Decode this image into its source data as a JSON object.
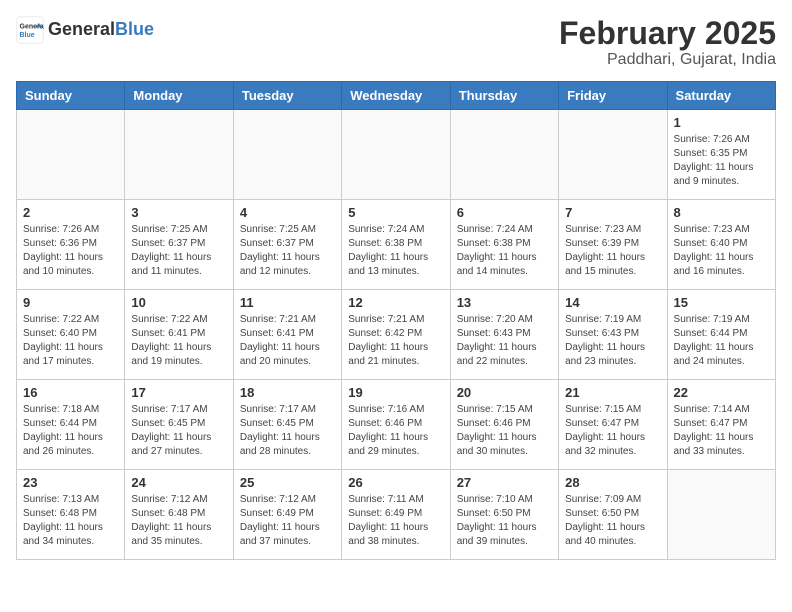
{
  "header": {
    "logo_general": "General",
    "logo_blue": "Blue",
    "month_year": "February 2025",
    "location": "Paddhari, Gujarat, India"
  },
  "weekdays": [
    "Sunday",
    "Monday",
    "Tuesday",
    "Wednesday",
    "Thursday",
    "Friday",
    "Saturday"
  ],
  "weeks": [
    [
      {
        "day": "",
        "info": ""
      },
      {
        "day": "",
        "info": ""
      },
      {
        "day": "",
        "info": ""
      },
      {
        "day": "",
        "info": ""
      },
      {
        "day": "",
        "info": ""
      },
      {
        "day": "",
        "info": ""
      },
      {
        "day": "1",
        "info": "Sunrise: 7:26 AM\nSunset: 6:35 PM\nDaylight: 11 hours\nand 9 minutes."
      }
    ],
    [
      {
        "day": "2",
        "info": "Sunrise: 7:26 AM\nSunset: 6:36 PM\nDaylight: 11 hours\nand 10 minutes."
      },
      {
        "day": "3",
        "info": "Sunrise: 7:25 AM\nSunset: 6:37 PM\nDaylight: 11 hours\nand 11 minutes."
      },
      {
        "day": "4",
        "info": "Sunrise: 7:25 AM\nSunset: 6:37 PM\nDaylight: 11 hours\nand 12 minutes."
      },
      {
        "day": "5",
        "info": "Sunrise: 7:24 AM\nSunset: 6:38 PM\nDaylight: 11 hours\nand 13 minutes."
      },
      {
        "day": "6",
        "info": "Sunrise: 7:24 AM\nSunset: 6:38 PM\nDaylight: 11 hours\nand 14 minutes."
      },
      {
        "day": "7",
        "info": "Sunrise: 7:23 AM\nSunset: 6:39 PM\nDaylight: 11 hours\nand 15 minutes."
      },
      {
        "day": "8",
        "info": "Sunrise: 7:23 AM\nSunset: 6:40 PM\nDaylight: 11 hours\nand 16 minutes."
      }
    ],
    [
      {
        "day": "9",
        "info": "Sunrise: 7:22 AM\nSunset: 6:40 PM\nDaylight: 11 hours\nand 17 minutes."
      },
      {
        "day": "10",
        "info": "Sunrise: 7:22 AM\nSunset: 6:41 PM\nDaylight: 11 hours\nand 19 minutes."
      },
      {
        "day": "11",
        "info": "Sunrise: 7:21 AM\nSunset: 6:41 PM\nDaylight: 11 hours\nand 20 minutes."
      },
      {
        "day": "12",
        "info": "Sunrise: 7:21 AM\nSunset: 6:42 PM\nDaylight: 11 hours\nand 21 minutes."
      },
      {
        "day": "13",
        "info": "Sunrise: 7:20 AM\nSunset: 6:43 PM\nDaylight: 11 hours\nand 22 minutes."
      },
      {
        "day": "14",
        "info": "Sunrise: 7:19 AM\nSunset: 6:43 PM\nDaylight: 11 hours\nand 23 minutes."
      },
      {
        "day": "15",
        "info": "Sunrise: 7:19 AM\nSunset: 6:44 PM\nDaylight: 11 hours\nand 24 minutes."
      }
    ],
    [
      {
        "day": "16",
        "info": "Sunrise: 7:18 AM\nSunset: 6:44 PM\nDaylight: 11 hours\nand 26 minutes."
      },
      {
        "day": "17",
        "info": "Sunrise: 7:17 AM\nSunset: 6:45 PM\nDaylight: 11 hours\nand 27 minutes."
      },
      {
        "day": "18",
        "info": "Sunrise: 7:17 AM\nSunset: 6:45 PM\nDaylight: 11 hours\nand 28 minutes."
      },
      {
        "day": "19",
        "info": "Sunrise: 7:16 AM\nSunset: 6:46 PM\nDaylight: 11 hours\nand 29 minutes."
      },
      {
        "day": "20",
        "info": "Sunrise: 7:15 AM\nSunset: 6:46 PM\nDaylight: 11 hours\nand 30 minutes."
      },
      {
        "day": "21",
        "info": "Sunrise: 7:15 AM\nSunset: 6:47 PM\nDaylight: 11 hours\nand 32 minutes."
      },
      {
        "day": "22",
        "info": "Sunrise: 7:14 AM\nSunset: 6:47 PM\nDaylight: 11 hours\nand 33 minutes."
      }
    ],
    [
      {
        "day": "23",
        "info": "Sunrise: 7:13 AM\nSunset: 6:48 PM\nDaylight: 11 hours\nand 34 minutes."
      },
      {
        "day": "24",
        "info": "Sunrise: 7:12 AM\nSunset: 6:48 PM\nDaylight: 11 hours\nand 35 minutes."
      },
      {
        "day": "25",
        "info": "Sunrise: 7:12 AM\nSunset: 6:49 PM\nDaylight: 11 hours\nand 37 minutes."
      },
      {
        "day": "26",
        "info": "Sunrise: 7:11 AM\nSunset: 6:49 PM\nDaylight: 11 hours\nand 38 minutes."
      },
      {
        "day": "27",
        "info": "Sunrise: 7:10 AM\nSunset: 6:50 PM\nDaylight: 11 hours\nand 39 minutes."
      },
      {
        "day": "28",
        "info": "Sunrise: 7:09 AM\nSunset: 6:50 PM\nDaylight: 11 hours\nand 40 minutes."
      },
      {
        "day": "",
        "info": ""
      }
    ]
  ]
}
